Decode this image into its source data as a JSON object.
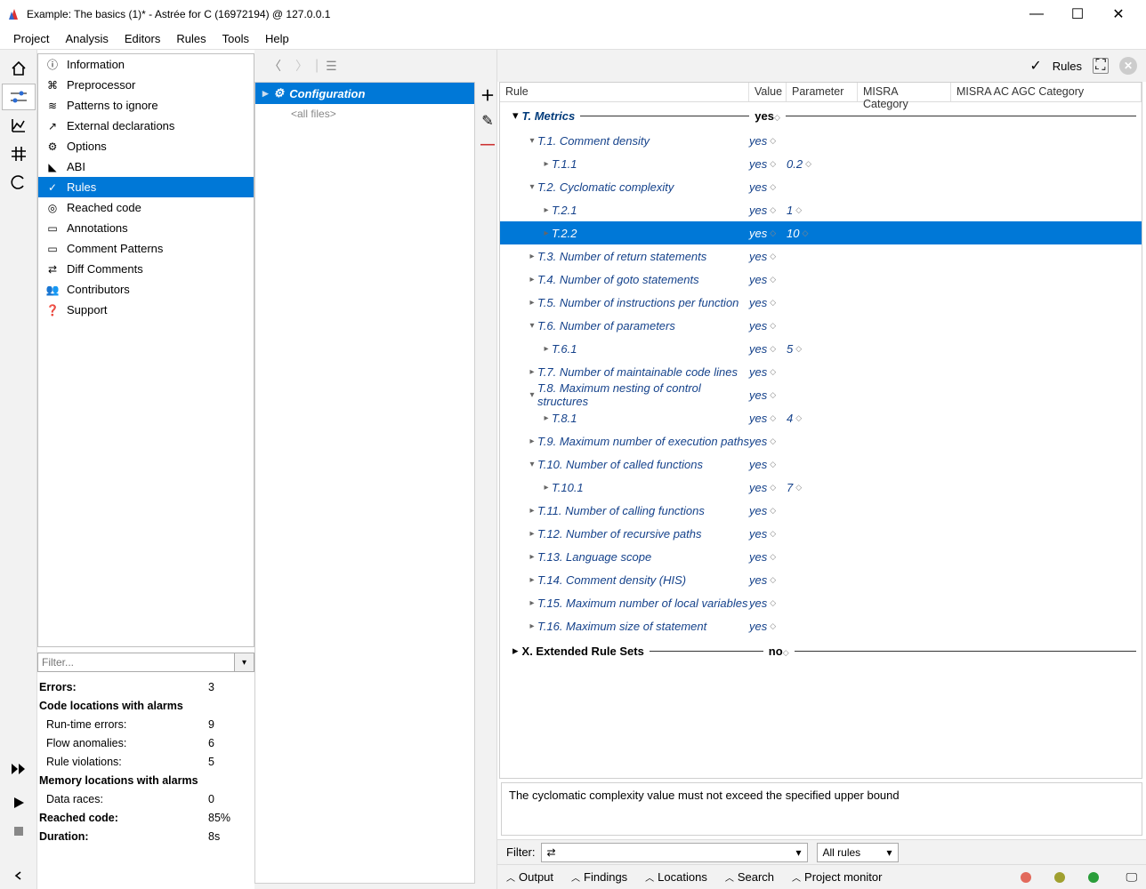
{
  "window": {
    "title": "Example: The basics (1)* - Astrée for C (16972194) @ 127.0.0.1"
  },
  "menu": {
    "items": [
      "Project",
      "Analysis",
      "Editors",
      "Rules",
      "Tools",
      "Help"
    ]
  },
  "nav": {
    "items": [
      {
        "icon": "ⓘ",
        "label": "Information"
      },
      {
        "icon": "⌘",
        "label": "Preprocessor"
      },
      {
        "icon": "≋",
        "label": "Patterns to ignore"
      },
      {
        "icon": "↗",
        "label": "External declarations"
      },
      {
        "icon": "⚙",
        "label": "Options"
      },
      {
        "icon": "◣",
        "label": "ABI"
      },
      {
        "icon": "✓",
        "label": "Rules",
        "sel": true
      },
      {
        "icon": "◎",
        "label": "Reached code"
      },
      {
        "icon": "▭",
        "label": "Annotations"
      },
      {
        "icon": "▭",
        "label": "Comment Patterns"
      },
      {
        "icon": "⇄",
        "label": "Diff Comments"
      },
      {
        "icon": "👥",
        "label": "Contributors"
      },
      {
        "icon": "❓",
        "label": "Support"
      }
    ]
  },
  "filter": {
    "placeholder": "Filter..."
  },
  "stats": {
    "errors_label": "Errors:",
    "errors": "3",
    "cl_hdr": "Code locations with alarms",
    "rte_label": "Run-time errors:",
    "rte": "9",
    "fa_label": "Flow anomalies:",
    "fa": "6",
    "rv_label": "Rule violations:",
    "rv": "5",
    "ml_hdr": "Memory locations with alarms",
    "dr_label": "Data races:",
    "dr": "0",
    "rc_label": "Reached code:",
    "rc": "85%",
    "dur_label": "Duration:",
    "dur": "8s"
  },
  "config": {
    "title": "Configuration",
    "files": "<all files>"
  },
  "righttop": {
    "rules": "Rules"
  },
  "columns": {
    "rule": "Rule",
    "value": "Value",
    "param": "Parameter",
    "misra": "MISRA Category",
    "misraac": "MISRA AC AGC Category"
  },
  "cat": {
    "metrics": "T. Metrics",
    "metrics_val": "yes",
    "ext": "X. Extended Rule Sets",
    "ext_val": "no"
  },
  "rows": [
    {
      "ind": 30,
      "arr": "▾",
      "label": "T.1. Comment density",
      "val": "yes"
    },
    {
      "ind": 46,
      "arr": "▸",
      "label": "T.1.1",
      "val": "yes",
      "par": "0.2"
    },
    {
      "ind": 30,
      "arr": "▾",
      "label": "T.2. Cyclomatic complexity",
      "val": "yes"
    },
    {
      "ind": 46,
      "arr": "▸",
      "label": "T.2.1",
      "val": "yes",
      "par": "1"
    },
    {
      "ind": 46,
      "arr": "▸",
      "label": "T.2.2",
      "val": "yes",
      "par": "10",
      "sel": true
    },
    {
      "ind": 30,
      "arr": "▸",
      "label": "T.3. Number of return statements",
      "val": "yes"
    },
    {
      "ind": 30,
      "arr": "▸",
      "label": "T.4. Number of goto statements",
      "val": "yes"
    },
    {
      "ind": 30,
      "arr": "▸",
      "label": "T.5. Number of instructions per function",
      "val": "yes"
    },
    {
      "ind": 30,
      "arr": "▾",
      "label": "T.6. Number of parameters",
      "val": "yes"
    },
    {
      "ind": 46,
      "arr": "▸",
      "label": "T.6.1",
      "val": "yes",
      "par": "5"
    },
    {
      "ind": 30,
      "arr": "▸",
      "label": "T.7. Number of maintainable code lines",
      "val": "yes"
    },
    {
      "ind": 30,
      "arr": "▾",
      "label": "T.8. Maximum nesting of control structures",
      "val": "yes"
    },
    {
      "ind": 46,
      "arr": "▸",
      "label": "T.8.1",
      "val": "yes",
      "par": "4"
    },
    {
      "ind": 30,
      "arr": "▸",
      "label": "T.9. Maximum number of execution paths",
      "val": "yes"
    },
    {
      "ind": 30,
      "arr": "▾",
      "label": "T.10. Number of called functions",
      "val": "yes"
    },
    {
      "ind": 46,
      "arr": "▸",
      "label": "T.10.1",
      "val": "yes",
      "par": "7"
    },
    {
      "ind": 30,
      "arr": "▸",
      "label": "T.11. Number of calling functions",
      "val": "yes"
    },
    {
      "ind": 30,
      "arr": "▸",
      "label": "T.12. Number of recursive paths",
      "val": "yes"
    },
    {
      "ind": 30,
      "arr": "▸",
      "label": "T.13. Language scope",
      "val": "yes"
    },
    {
      "ind": 30,
      "arr": "▸",
      "label": "T.14. Comment density (HIS)",
      "val": "yes"
    },
    {
      "ind": 30,
      "arr": "▸",
      "label": "T.15. Maximum number of local variables",
      "val": "yes"
    },
    {
      "ind": 30,
      "arr": "▸",
      "label": "T.16. Maximum size of statement",
      "val": "yes"
    }
  ],
  "detail": "The cyclomatic complexity value must not exceed the specified upper bound",
  "bottomfilter": {
    "label": "Filter:",
    "all_rules": "All rules"
  },
  "panels": {
    "output": "Output",
    "findings": "Findings",
    "locations": "Locations",
    "search": "Search",
    "pm": "Project monitor"
  },
  "status": {
    "colors": [
      "#e26a5c",
      "#a0a030",
      "#2a9d3a"
    ]
  }
}
